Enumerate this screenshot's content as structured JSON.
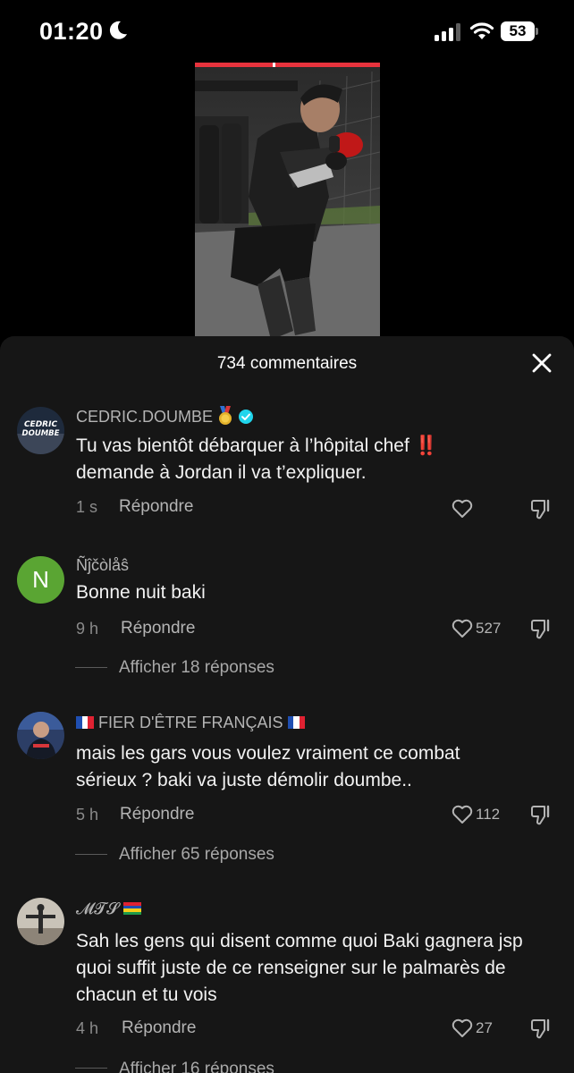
{
  "status_bar": {
    "time": "01:20",
    "battery_level": "53",
    "icons": [
      "moon-icon",
      "signal-icon",
      "wifi-icon",
      "battery-icon"
    ]
  },
  "video": {
    "progress": 0.42,
    "thumbnail": "fighter-shadowboxing-thumbnail"
  },
  "comments_sheet": {
    "title": "734 commentaires",
    "close_icon": "close-icon",
    "comments": [
      {
        "username": "CEDRIC.DOUMBE",
        "badges": [
          "medal-icon",
          "verified-icon"
        ],
        "text_line1": "Tu vas bientôt débarquer à l’hôpital chef ",
        "text_emphasis": "‼️",
        "text_line2": "demande à Jordan il va t’expliquer.",
        "time": "1 s",
        "reply_label": "Répondre",
        "likes": ""
      },
      {
        "username": "Ñĵčòlåŝ",
        "avatar_letter": "N",
        "text": "Bonne nuit baki",
        "time": "9 h",
        "reply_label": "Répondre",
        "likes": "527",
        "replies_label": "Afficher 18 réponses"
      },
      {
        "username": "FIER D'ÊTRE FRANÇAIS",
        "flag": "france-flag",
        "text": "mais les gars vous voulez vraiment ce combat sérieux ? baki va juste démolir doumbe..",
        "time": "5 h",
        "reply_label": "Répondre",
        "likes": "112",
        "replies_label": "Afficher 65 réponses"
      },
      {
        "username": "𝓜𝓣𝓢",
        "flag": "mauritius-flag",
        "text": "Sah les gens qui disent comme quoi Baki gagnera jsp quoi suffit juste de ce renseigner sur le palmarès de chacun et tu vois",
        "time": "4 h",
        "reply_label": "Répondre",
        "likes": "27",
        "replies_label": "Afficher 16 réponses"
      }
    ]
  },
  "colors": {
    "sheet_bg": "#161616",
    "progress": "#e8333d",
    "verified": "#20d5ec",
    "avatar_green": "#5aa533"
  }
}
